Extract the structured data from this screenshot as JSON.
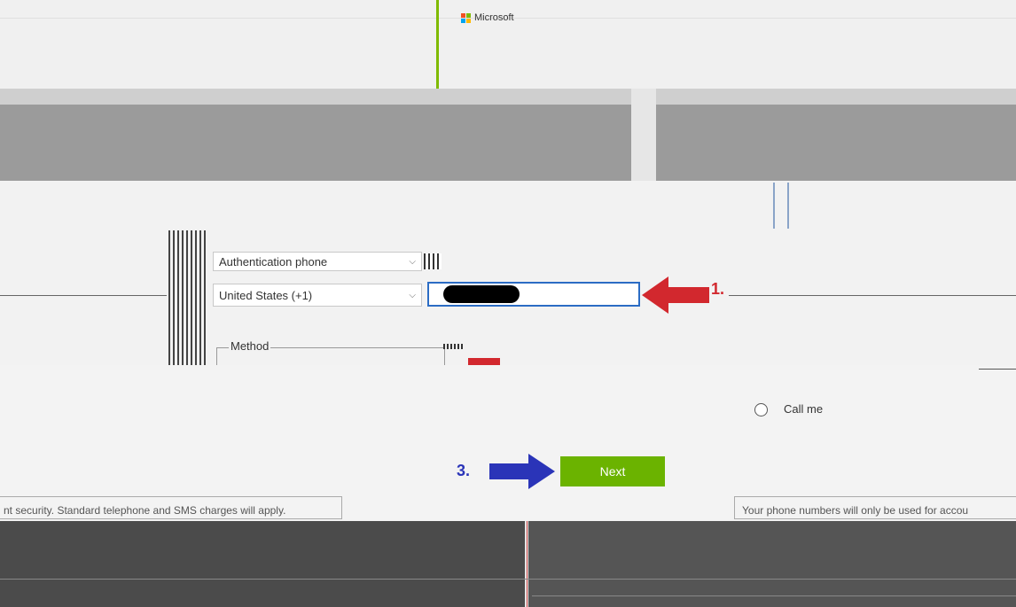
{
  "header": {
    "brand": "Microsoft"
  },
  "colors": {
    "accent_green": "#6bb300",
    "arrow_red": "#d2282e",
    "arrow_blue": "#2a34b8",
    "banner_gray": "#9b9b9b",
    "focus_blue": "#2b6cc4"
  },
  "icons": [
    "microsoft-logo-icon",
    "chevron-down-icon",
    "radio-icon",
    "arrow-left-icon",
    "arrow-right-icon"
  ],
  "form": {
    "phone_type": "Authentication phone",
    "country": "United States (+1)",
    "phone_value": "",
    "method_legend": "Method",
    "call_option": "Call me"
  },
  "annotations": {
    "step1": "1.",
    "step3": "3."
  },
  "actions": {
    "next_label": "Next"
  },
  "notes": {
    "left": "nt security. Standard telephone and SMS charges will apply.",
    "right": "Your phone numbers will only be used for accou"
  }
}
